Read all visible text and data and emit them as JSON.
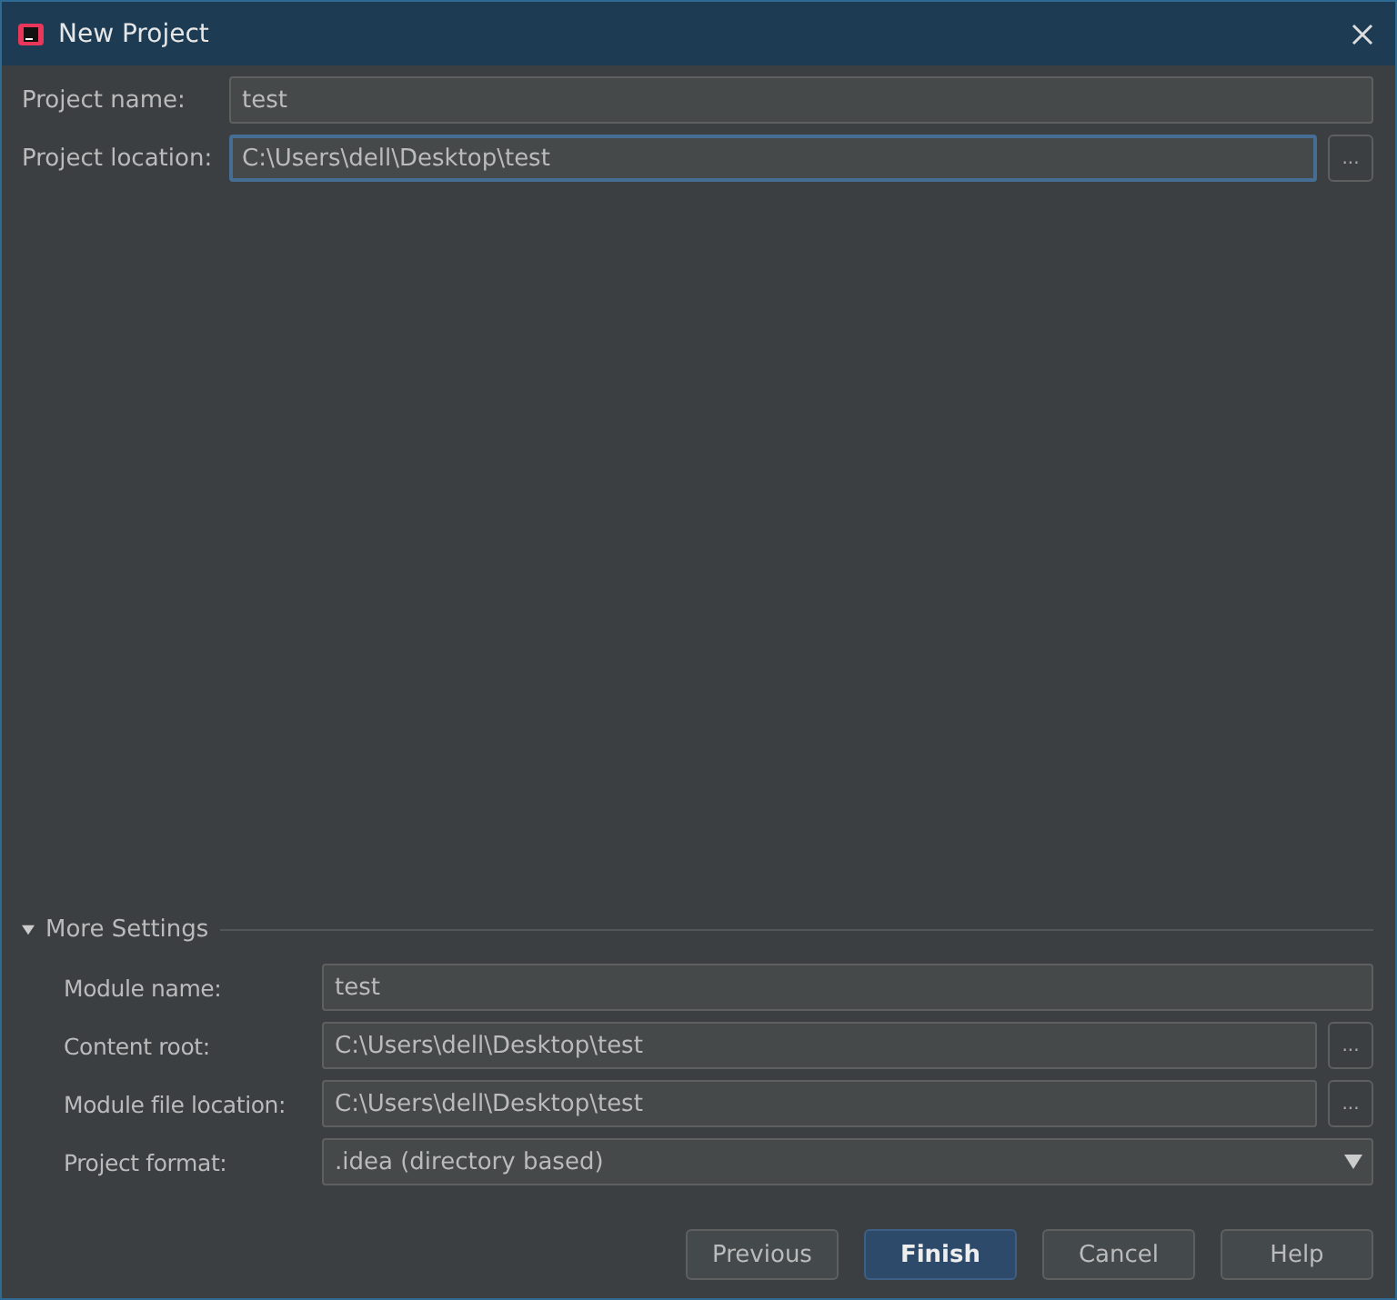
{
  "window": {
    "title": "New Project"
  },
  "project_fields": [
    {
      "label": "Project name:",
      "value": "test",
      "focused": false
    },
    {
      "label": "Project location:",
      "value": "C:\\Users\\dell\\Desktop\\test",
      "focused": true,
      "browse": "..."
    }
  ],
  "more_settings": {
    "label": "More Settings",
    "expanded": true,
    "fields": [
      {
        "kind": "text",
        "label": "Module name:",
        "value": "test"
      },
      {
        "kind": "path",
        "label": "Content root:",
        "value": "C:\\Users\\dell\\Desktop\\test",
        "browse": "..."
      },
      {
        "kind": "path",
        "label": "Module file location:",
        "value": "C:\\Users\\dell\\Desktop\\test",
        "browse": "..."
      },
      {
        "kind": "select",
        "label": "Project format:",
        "value": ".idea (directory based)"
      }
    ]
  },
  "buttons": [
    {
      "label": "Previous",
      "default": false
    },
    {
      "label": "Finish",
      "default": true
    },
    {
      "label": "Cancel",
      "default": false
    },
    {
      "label": "Help",
      "default": false
    }
  ]
}
